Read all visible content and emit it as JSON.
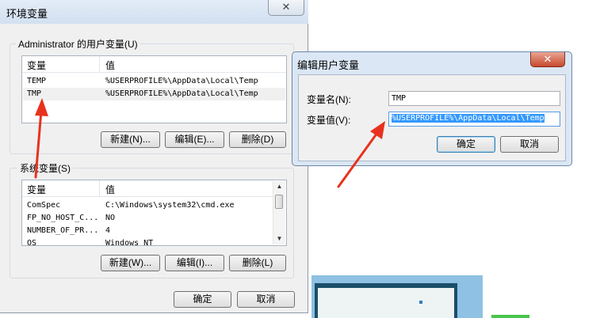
{
  "main_dialog": {
    "title": "环境变量",
    "close_glyph": "✕",
    "user_group": {
      "label": "Administrator 的用户变量(U)",
      "columns": [
        "变量",
        "值"
      ],
      "rows": [
        {
          "name": "TEMP",
          "value": "%USERPROFILE%\\AppData\\Local\\Temp"
        },
        {
          "name": "TMP",
          "value": "%USERPROFILE%\\AppData\\Local\\Temp"
        }
      ],
      "buttons": {
        "new": "新建(N)...",
        "edit": "编辑(E)...",
        "delete": "删除(D)"
      }
    },
    "system_group": {
      "label": "系统变量(S)",
      "columns": [
        "变量",
        "值"
      ],
      "rows": [
        {
          "name": "ComSpec",
          "value": "C:\\Windows\\system32\\cmd.exe"
        },
        {
          "name": "FP_NO_HOST_C...",
          "value": "NO"
        },
        {
          "name": "NUMBER_OF_PR...",
          "value": "4"
        },
        {
          "name": "OS",
          "value": "Windows_NT"
        }
      ],
      "buttons": {
        "new": "新建(W)...",
        "edit": "编辑(I)...",
        "delete": "删除(L)"
      }
    },
    "ok": "确定",
    "cancel": "取消"
  },
  "edit_dialog": {
    "title": "编辑用户变量",
    "close_glyph": "✕",
    "name_label": "变量名(N):",
    "name_value": "TMP",
    "value_label": "变量值(V):",
    "value_value": "%USERPROFILE%\\AppData\\Local\\Temp",
    "ok": "确定",
    "cancel": "取消"
  },
  "colors": {
    "annotation_arrow": "#e8321e",
    "selection": "#3399ff",
    "edit_title_bg": "#dbe7f5"
  },
  "icons": {
    "close": "close-icon",
    "scroll_up": "chevron-up-icon",
    "scroll_down": "chevron-down-icon"
  }
}
